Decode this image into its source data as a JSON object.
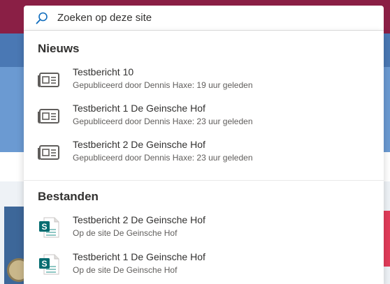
{
  "search": {
    "value": "Zoeken op deze site"
  },
  "news": {
    "heading": "Nieuws",
    "items": [
      {
        "title": "Testbericht 10",
        "subtitle": "Gepubliceerd door Dennis Haxe: 19 uur geleden",
        "icon": "news-icon"
      },
      {
        "title": "Testbericht 1 De Geinsche Hof",
        "subtitle": "Gepubliceerd door Dennis Haxe: 23 uur geleden",
        "icon": "news-icon"
      },
      {
        "title": "Testbericht 2 De Geinsche Hof",
        "subtitle": "Gepubliceerd door Dennis Haxe: 23 uur geleden",
        "icon": "news-icon"
      }
    ]
  },
  "files": {
    "heading": "Bestanden",
    "items": [
      {
        "title": "Testbericht 2 De Geinsche Hof",
        "subtitle": "Op de site De Geinsche Hof",
        "icon": "sharepoint-page-icon"
      },
      {
        "title": "Testbericht 1 De Geinsche Hof",
        "subtitle": "Op de site De Geinsche Hof",
        "icon": "sharepoint-page-icon"
      }
    ]
  },
  "colors": {
    "suite_bar": "#8a1f45",
    "nav_bar": "#4a78b4",
    "sharepoint_green": "#036c70",
    "search_icon_accent": "#0f6cbd"
  }
}
